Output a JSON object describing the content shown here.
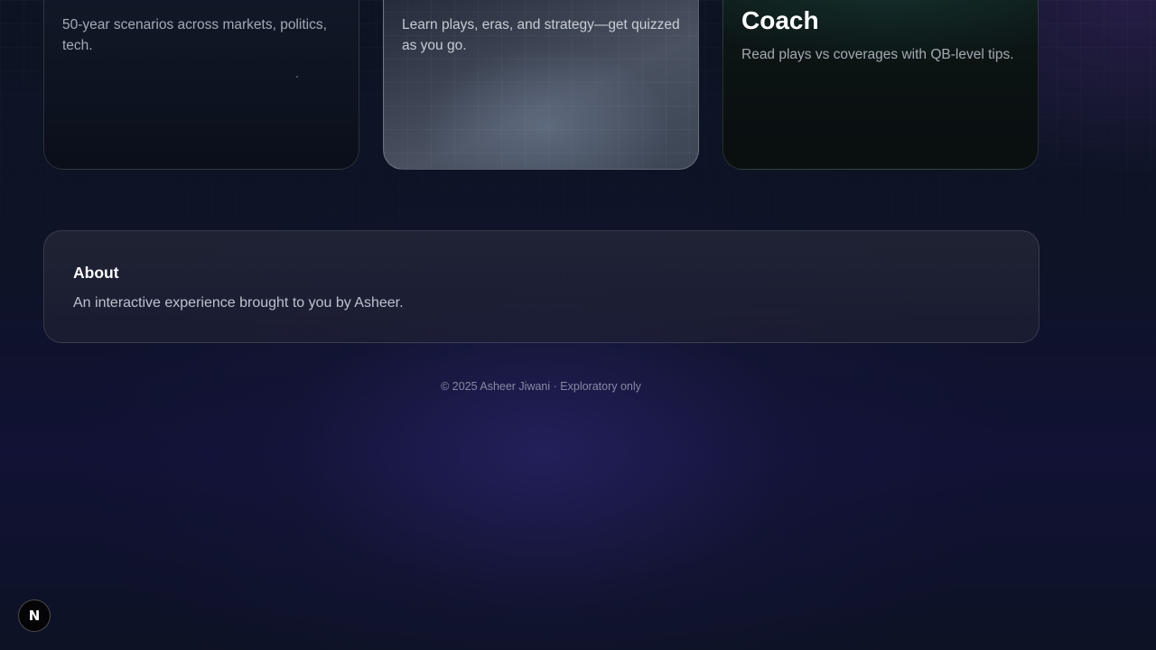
{
  "cards": [
    {
      "title": "",
      "description": "50-year scenarios across markets, politics, tech."
    },
    {
      "title": "",
      "description": "Learn plays, eras, and strategy—get quizzed as you go."
    },
    {
      "title": "Coach",
      "description": "Read plays vs coverages with QB-level tips."
    }
  ],
  "about": {
    "heading": "About",
    "text": "An interactive experience brought to you by Asheer."
  },
  "footer": {
    "text": "© 2025 Asheer Jiwani · Exploratory only"
  },
  "dev_badge": {
    "label": "N",
    "icon": "nextjs-icon"
  },
  "colors": {
    "background": "#0b1220",
    "accent_glow": "#312a78",
    "card_border": "#2a3040"
  }
}
